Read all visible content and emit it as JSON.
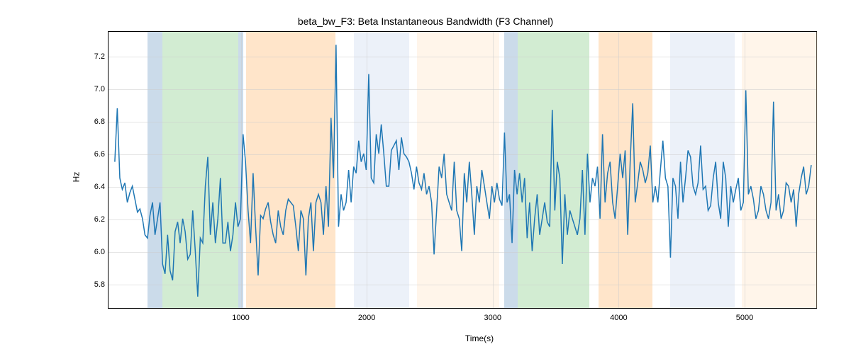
{
  "chart_data": {
    "type": "line",
    "title": "beta_bw_F3: Beta Instantaneous Bandwidth (F3 Channel)",
    "xlabel": "Time(s)",
    "ylabel": "Hz",
    "xlim": [
      -50,
      5580
    ],
    "ylim": [
      5.65,
      7.35
    ],
    "xticks": [
      1000,
      2000,
      3000,
      4000,
      5000
    ],
    "yticks": [
      5.8,
      6.0,
      6.2,
      6.4,
      6.6,
      6.8,
      7.0,
      7.2
    ],
    "bands": [
      {
        "start": 260,
        "end": 380,
        "color": "#6b97c2"
      },
      {
        "start": 380,
        "end": 980,
        "color": "#7ec97e"
      },
      {
        "start": 980,
        "end": 1020,
        "color": "#6b97c2"
      },
      {
        "start": 1040,
        "end": 1750,
        "color": "#ffb566"
      },
      {
        "start": 1900,
        "end": 2340,
        "color": "#c8d8ed"
      },
      {
        "start": 2400,
        "end": 3050,
        "color": "#ffe3c2"
      },
      {
        "start": 3090,
        "end": 3200,
        "color": "#6b97c2"
      },
      {
        "start": 3200,
        "end": 3770,
        "color": "#7ec97e"
      },
      {
        "start": 3840,
        "end": 4270,
        "color": "#ffb566"
      },
      {
        "start": 4410,
        "end": 4920,
        "color": "#c8d8ed"
      },
      {
        "start": 4980,
        "end": 5580,
        "color": "#ffe3c2"
      }
    ],
    "series": [
      {
        "name": "beta_bw_F3",
        "x": [
          0,
          20,
          40,
          60,
          80,
          100,
          120,
          140,
          160,
          180,
          200,
          220,
          240,
          260,
          280,
          300,
          320,
          340,
          360,
          380,
          400,
          420,
          440,
          460,
          480,
          500,
          520,
          540,
          560,
          580,
          600,
          620,
          640,
          660,
          680,
          700,
          720,
          740,
          760,
          780,
          800,
          820,
          840,
          860,
          880,
          900,
          920,
          940,
          960,
          980,
          1000,
          1020,
          1040,
          1060,
          1080,
          1100,
          1120,
          1140,
          1160,
          1180,
          1200,
          1220,
          1240,
          1260,
          1280,
          1300,
          1320,
          1340,
          1360,
          1380,
          1400,
          1420,
          1440,
          1460,
          1480,
          1500,
          1520,
          1540,
          1560,
          1580,
          1600,
          1620,
          1640,
          1660,
          1680,
          1700,
          1720,
          1740,
          1760,
          1780,
          1800,
          1820,
          1840,
          1860,
          1880,
          1900,
          1920,
          1940,
          1960,
          1980,
          2000,
          2020,
          2040,
          2060,
          2080,
          2100,
          2120,
          2140,
          2160,
          2180,
          2200,
          2220,
          2240,
          2260,
          2280,
          2300,
          2320,
          2340,
          2360,
          2380,
          2400,
          2420,
          2440,
          2460,
          2480,
          2500,
          2520,
          2540,
          2560,
          2580,
          2600,
          2620,
          2640,
          2660,
          2680,
          2700,
          2720,
          2740,
          2760,
          2780,
          2800,
          2820,
          2840,
          2860,
          2880,
          2900,
          2920,
          2940,
          2960,
          2980,
          3000,
          3020,
          3040,
          3060,
          3080,
          3100,
          3120,
          3140,
          3160,
          3180,
          3200,
          3220,
          3240,
          3260,
          3280,
          3300,
          3320,
          3340,
          3360,
          3380,
          3400,
          3420,
          3440,
          3460,
          3480,
          3500,
          3520,
          3540,
          3560,
          3580,
          3600,
          3620,
          3640,
          3660,
          3680,
          3700,
          3720,
          3740,
          3760,
          3780,
          3800,
          3820,
          3840,
          3860,
          3880,
          3900,
          3920,
          3940,
          3960,
          3980,
          4000,
          4020,
          4040,
          4060,
          4080,
          4100,
          4120,
          4140,
          4160,
          4180,
          4200,
          4220,
          4240,
          4260,
          4280,
          4300,
          4320,
          4340,
          4360,
          4380,
          4400,
          4420,
          4440,
          4460,
          4480,
          4500,
          4520,
          4540,
          4560,
          4580,
          4600,
          4620,
          4640,
          4660,
          4680,
          4700,
          4720,
          4740,
          4760,
          4780,
          4800,
          4820,
          4840,
          4860,
          4880,
          4900,
          4920,
          4940,
          4960,
          4980,
          5000,
          5020,
          5040,
          5060,
          5080,
          5100,
          5120,
          5140,
          5160,
          5180,
          5200,
          5220,
          5240,
          5260,
          5280,
          5300,
          5320,
          5340,
          5360,
          5380,
          5400,
          5420,
          5440,
          5460,
          5480,
          5500,
          5520,
          5540
        ],
        "y": [
          6.55,
          6.88,
          6.45,
          6.38,
          6.42,
          6.3,
          6.36,
          6.4,
          6.32,
          6.24,
          6.26,
          6.2,
          6.1,
          6.08,
          6.22,
          6.3,
          6.1,
          6.2,
          6.3,
          5.92,
          5.86,
          6.1,
          5.88,
          5.82,
          6.12,
          6.18,
          6.05,
          6.2,
          6.12,
          5.95,
          5.98,
          6.25,
          6.0,
          5.72,
          6.08,
          6.05,
          6.4,
          6.58,
          6.1,
          6.3,
          6.05,
          6.2,
          6.45,
          6.05,
          6.05,
          6.18,
          6.0,
          6.1,
          6.3,
          6.15,
          6.2,
          6.72,
          6.55,
          6.25,
          6.05,
          6.48,
          6.15,
          5.85,
          6.22,
          6.2,
          6.26,
          6.3,
          6.18,
          6.1,
          6.05,
          6.25,
          6.15,
          6.1,
          6.25,
          6.32,
          6.3,
          6.28,
          6.15,
          6.0,
          6.25,
          6.2,
          5.85,
          6.2,
          6.3,
          6.0,
          6.3,
          6.35,
          6.3,
          6.1,
          6.4,
          6.15,
          6.82,
          6.45,
          7.27,
          6.15,
          6.35,
          6.25,
          6.3,
          6.5,
          6.3,
          6.52,
          6.48,
          6.68,
          6.55,
          6.6,
          6.5,
          7.09,
          6.45,
          6.42,
          6.72,
          6.6,
          6.78,
          6.6,
          6.4,
          6.4,
          6.62,
          6.65,
          6.68,
          6.5,
          6.7,
          6.6,
          6.58,
          6.55,
          6.48,
          6.38,
          6.52,
          6.42,
          6.38,
          6.48,
          6.35,
          6.4,
          6.3,
          5.98,
          6.25,
          6.52,
          6.45,
          6.6,
          6.35,
          6.3,
          6.25,
          6.55,
          6.25,
          6.2,
          6.0,
          6.48,
          6.3,
          6.55,
          6.35,
          6.1,
          6.4,
          6.3,
          6.5,
          6.4,
          6.3,
          6.2,
          6.4,
          6.3,
          6.42,
          6.32,
          6.28,
          6.73,
          6.3,
          6.35,
          6.05,
          6.5,
          6.35,
          6.48,
          6.3,
          6.45,
          6.08,
          6.3,
          6.0,
          6.2,
          6.35,
          6.1,
          6.2,
          6.3,
          6.18,
          6.15,
          6.87,
          6.25,
          6.55,
          6.45,
          5.92,
          6.35,
          6.1,
          6.25,
          6.2,
          6.15,
          6.1,
          6.2,
          6.5,
          6.1,
          6.6,
          6.3,
          6.45,
          6.4,
          6.52,
          6.2,
          6.72,
          6.3,
          6.48,
          6.55,
          6.3,
          6.2,
          6.4,
          6.6,
          6.45,
          6.62,
          6.1,
          6.55,
          6.91,
          6.3,
          6.42,
          6.55,
          6.5,
          6.42,
          6.48,
          6.65,
          6.3,
          6.4,
          6.3,
          6.5,
          6.68,
          6.45,
          6.4,
          5.96,
          6.45,
          6.4,
          6.2,
          6.55,
          6.3,
          6.45,
          6.62,
          6.58,
          6.4,
          6.35,
          6.42,
          6.65,
          6.38,
          6.4,
          6.25,
          6.28,
          6.45,
          6.55,
          6.3,
          6.2,
          6.55,
          6.45,
          6.15,
          6.4,
          6.3,
          6.38,
          6.45,
          6.25,
          6.3,
          6.99,
          6.35,
          6.4,
          6.32,
          6.2,
          6.25,
          6.4,
          6.35,
          6.25,
          6.2,
          6.3,
          6.92,
          6.25,
          6.35,
          6.2,
          6.25,
          6.42,
          6.4,
          6.3,
          6.38,
          6.15,
          6.35,
          6.45,
          6.52,
          6.35,
          6.4,
          6.53
        ]
      }
    ]
  }
}
